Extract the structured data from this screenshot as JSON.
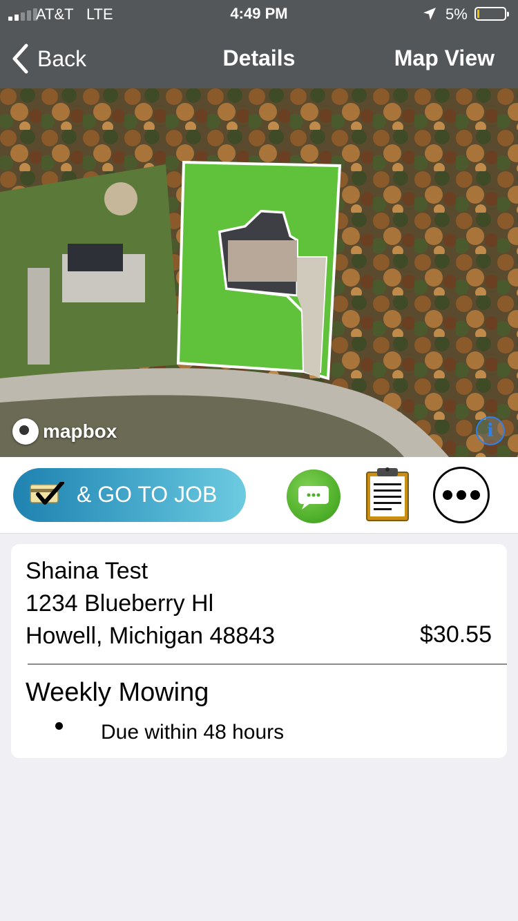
{
  "status_bar": {
    "carrier": "AT&T",
    "network": "LTE",
    "time": "4:49 PM",
    "battery_percent": "5%",
    "signal_bars": 2,
    "signal_bars_total": 5,
    "battery_level": 0.05,
    "battery_color": "#f2c200"
  },
  "nav": {
    "back_label": "Back",
    "title": "Details",
    "right_label": "Map View"
  },
  "map": {
    "attribution": "mapbox",
    "info_icon": "info-icon",
    "info_label": "i",
    "property_fill_color": "#5fc23a"
  },
  "actions": {
    "go_to_job_label": "& GO TO JOB",
    "go_to_job_icon": "card-check-icon",
    "chat_icon": "chat-bubble-icon",
    "notes_icon": "clipboard-icon",
    "more_icon": "more-icon"
  },
  "job": {
    "customer_name": "Shaina Test",
    "address_line1": "1234 Blueberry Hl",
    "address_line2": "Howell, Michigan 48843",
    "price": "$30.55",
    "service": "Weekly Mowing",
    "notes": [
      "Due within 48 hours"
    ]
  }
}
